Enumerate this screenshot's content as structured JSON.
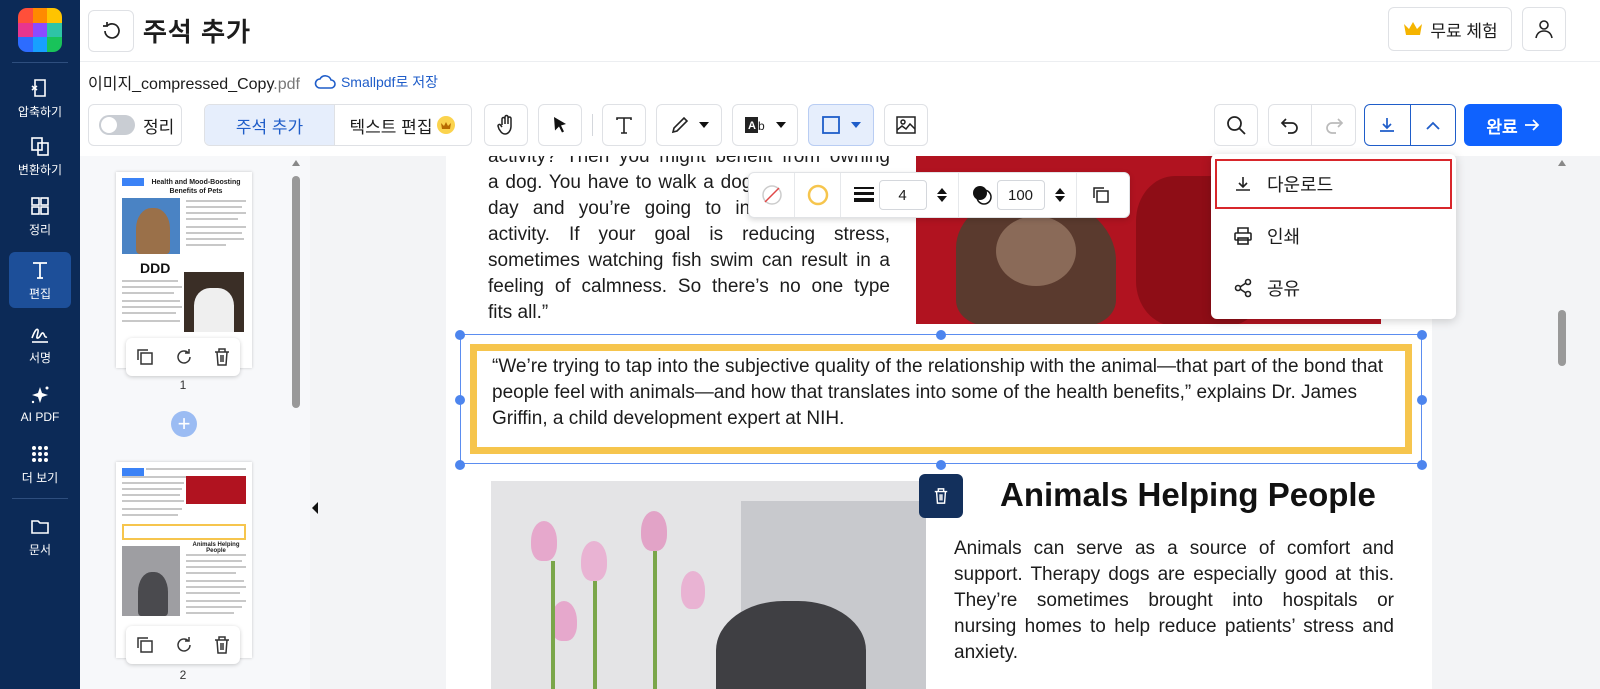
{
  "app": {
    "title": "주석 추가"
  },
  "sidebar": {
    "items": [
      {
        "label": "압축하기",
        "icon": "compress-icon"
      },
      {
        "label": "변환하기",
        "icon": "convert-icon"
      },
      {
        "label": "정리",
        "icon": "grid-icon"
      },
      {
        "label": "편집",
        "icon": "text-icon",
        "active": true
      },
      {
        "label": "서명",
        "icon": "signature-icon"
      },
      {
        "label": "AI PDF",
        "icon": "sparkle-icon"
      },
      {
        "label": "더 보기",
        "icon": "dots-grid-icon"
      },
      {
        "label": "문서",
        "icon": "folder-icon"
      }
    ]
  },
  "header": {
    "trial_label": "무료 체험"
  },
  "file": {
    "name": "이미지_compressed_Copy",
    "ext": ".pdf",
    "save_label": "Smallpdf로 저장"
  },
  "toolbar": {
    "organize_label": "정리",
    "tab_annotate": "주석 추가",
    "tab_edit_text": "텍스트 편집",
    "done_label": "완료"
  },
  "shape_toolbar": {
    "stroke_width": "4",
    "opacity": "100"
  },
  "download_menu": {
    "items": [
      "다운로드",
      "인쇄",
      "공유"
    ]
  },
  "thumbnails": {
    "pages": [
      {
        "number": "1",
        "title": "Health and Mood-Boosting Benefits of Pets",
        "overlay_text": "DDD"
      },
      {
        "number": "2",
        "title": "Animals Helping People"
      }
    ]
  },
  "document": {
    "para1_lines": [
      "activity? Then you might benefit from owning",
      "a dog. You have to walk a dog several times a",
      "day and you’re going to increase physical",
      "activity. If your goal is reducing stress,",
      "sometimes watching fish swim can result in a",
      "feeling of calmness. So there’s no one type",
      "fits all.”"
    ],
    "quote": "“We’re trying to tap into the subjective quality of the relationship with the animal—that part of the bond that people feel with animals—and how that translates into some of the health benefits,” explains Dr. James Griffin, a child development expert at NIH.",
    "heading": "Animals Helping People",
    "para2_lines": [
      "Animals can serve as a source of comfort and",
      "support. Therapy dogs are especially good at this.",
      "They’re sometimes brought into hospitals or",
      "nursing homes to help reduce patients’ stress and",
      "anxiety."
    ]
  },
  "colors": {
    "sidebar_bg": "#0c2a57",
    "accent": "#0f62fe",
    "annotation_rect": "#f6c54d",
    "highlight_outline": "#d8262b"
  }
}
